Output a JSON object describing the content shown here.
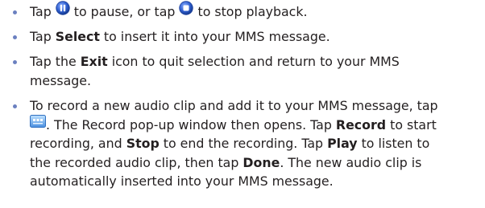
{
  "colors": {
    "bullet": "#6b80c0",
    "text": "#231f20",
    "icon_blue": "#2f5fd0"
  },
  "icons": {
    "pause": "pause-icon",
    "stop": "stop-icon",
    "record": "record-icon"
  },
  "items": [
    {
      "a": "Tap ",
      "b": " to pause, or tap ",
      "c": " to stop playback."
    },
    {
      "a": "Tap ",
      "bold1": "Select",
      "b": " to insert it into your MMS message."
    },
    {
      "a": "Tap the ",
      "bold1": "Exit",
      "b": " icon to quit selection and return to your MMS",
      "line2": "message."
    },
    {
      "l1": "To record a new audio clip and add it to your MMS message, tap",
      "l2a": ". The Record pop-up window then opens. Tap ",
      "l2bold": "Record",
      "l2b": " to start",
      "l3a": "recording, and ",
      "l3bold1": "Stop",
      "l3b": " to end the recording. Tap ",
      "l3bold2": "Play",
      "l3c": " to listen to",
      "l4a": "the recorded audio clip, then tap ",
      "l4bold": "Done",
      "l4b": ". The new audio clip is",
      "l5": "automatically inserted into your MMS message."
    }
  ]
}
